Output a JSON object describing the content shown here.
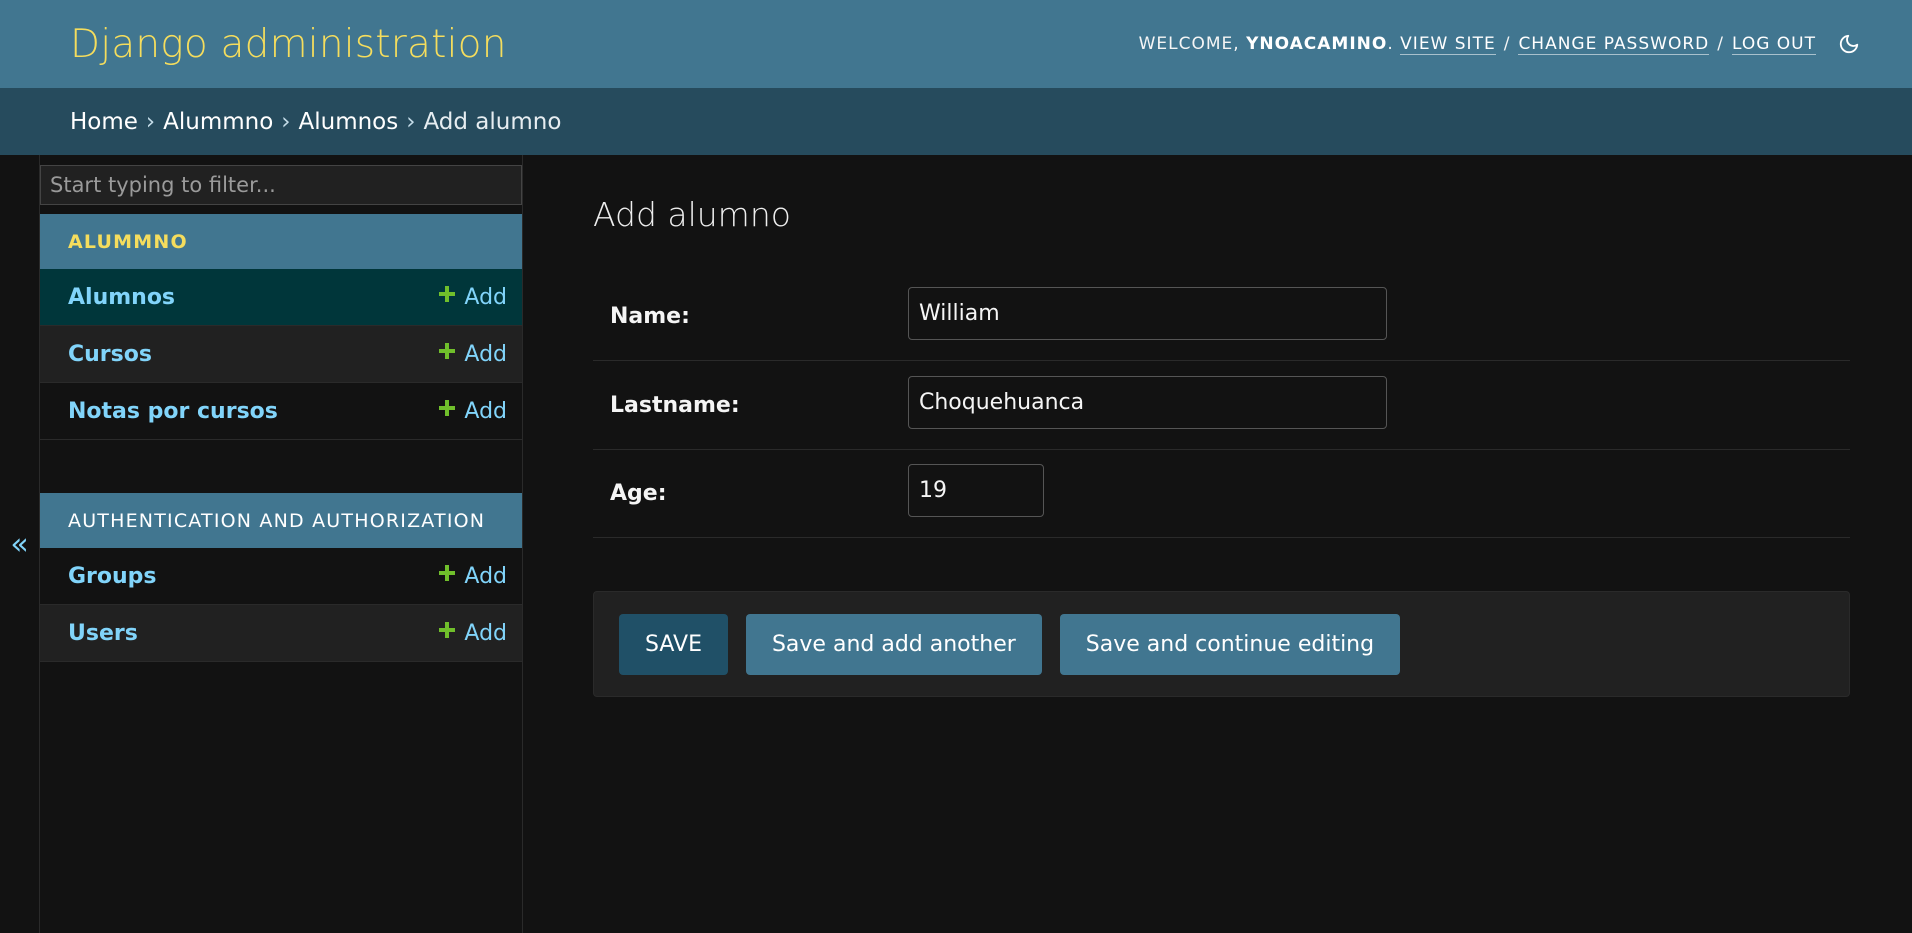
{
  "header": {
    "brand": "Django administration",
    "welcome": "WELCOME,",
    "username": "YNOACAMINO",
    "view_site": "VIEW SITE",
    "change_password": "CHANGE PASSWORD",
    "log_out": "LOG OUT",
    "separator": "/",
    "theme_icon": "moon-icon"
  },
  "breadcrumbs": {
    "items": [
      "Home",
      "Alummno",
      "Alumnos"
    ],
    "current": "Add alumno",
    "arrow": "›"
  },
  "sidebar": {
    "toggle_label": "«",
    "filter_placeholder": "Start typing to filter...",
    "modules": [
      {
        "caption": "ALUMMNO",
        "models": [
          {
            "name": "Alumnos",
            "add": "Add",
            "current": true
          },
          {
            "name": "Cursos",
            "add": "Add"
          },
          {
            "name": "Notas por cursos",
            "add": "Add"
          }
        ]
      },
      {
        "caption": "AUTHENTICATION AND AUTHORIZATION",
        "models": [
          {
            "name": "Groups",
            "add": "Add"
          },
          {
            "name": "Users",
            "add": "Add"
          }
        ]
      }
    ]
  },
  "content": {
    "title": "Add alumno",
    "fields": [
      {
        "label": "Name:",
        "value": "William"
      },
      {
        "label": "Lastname:",
        "value": "Choquehuanca"
      },
      {
        "label": "Age:",
        "value": "19"
      }
    ],
    "buttons": {
      "save": "SAVE",
      "save_add_another": "Save and add another",
      "save_continue": "Save and continue editing"
    }
  },
  "colors": {
    "header_bg": "#417690",
    "breadcrumbs_bg": "#264b5d",
    "brand": "#f5dd5d",
    "link": "#81d4fa",
    "add_plus": "#70bf2b",
    "body_bg": "#121212"
  }
}
